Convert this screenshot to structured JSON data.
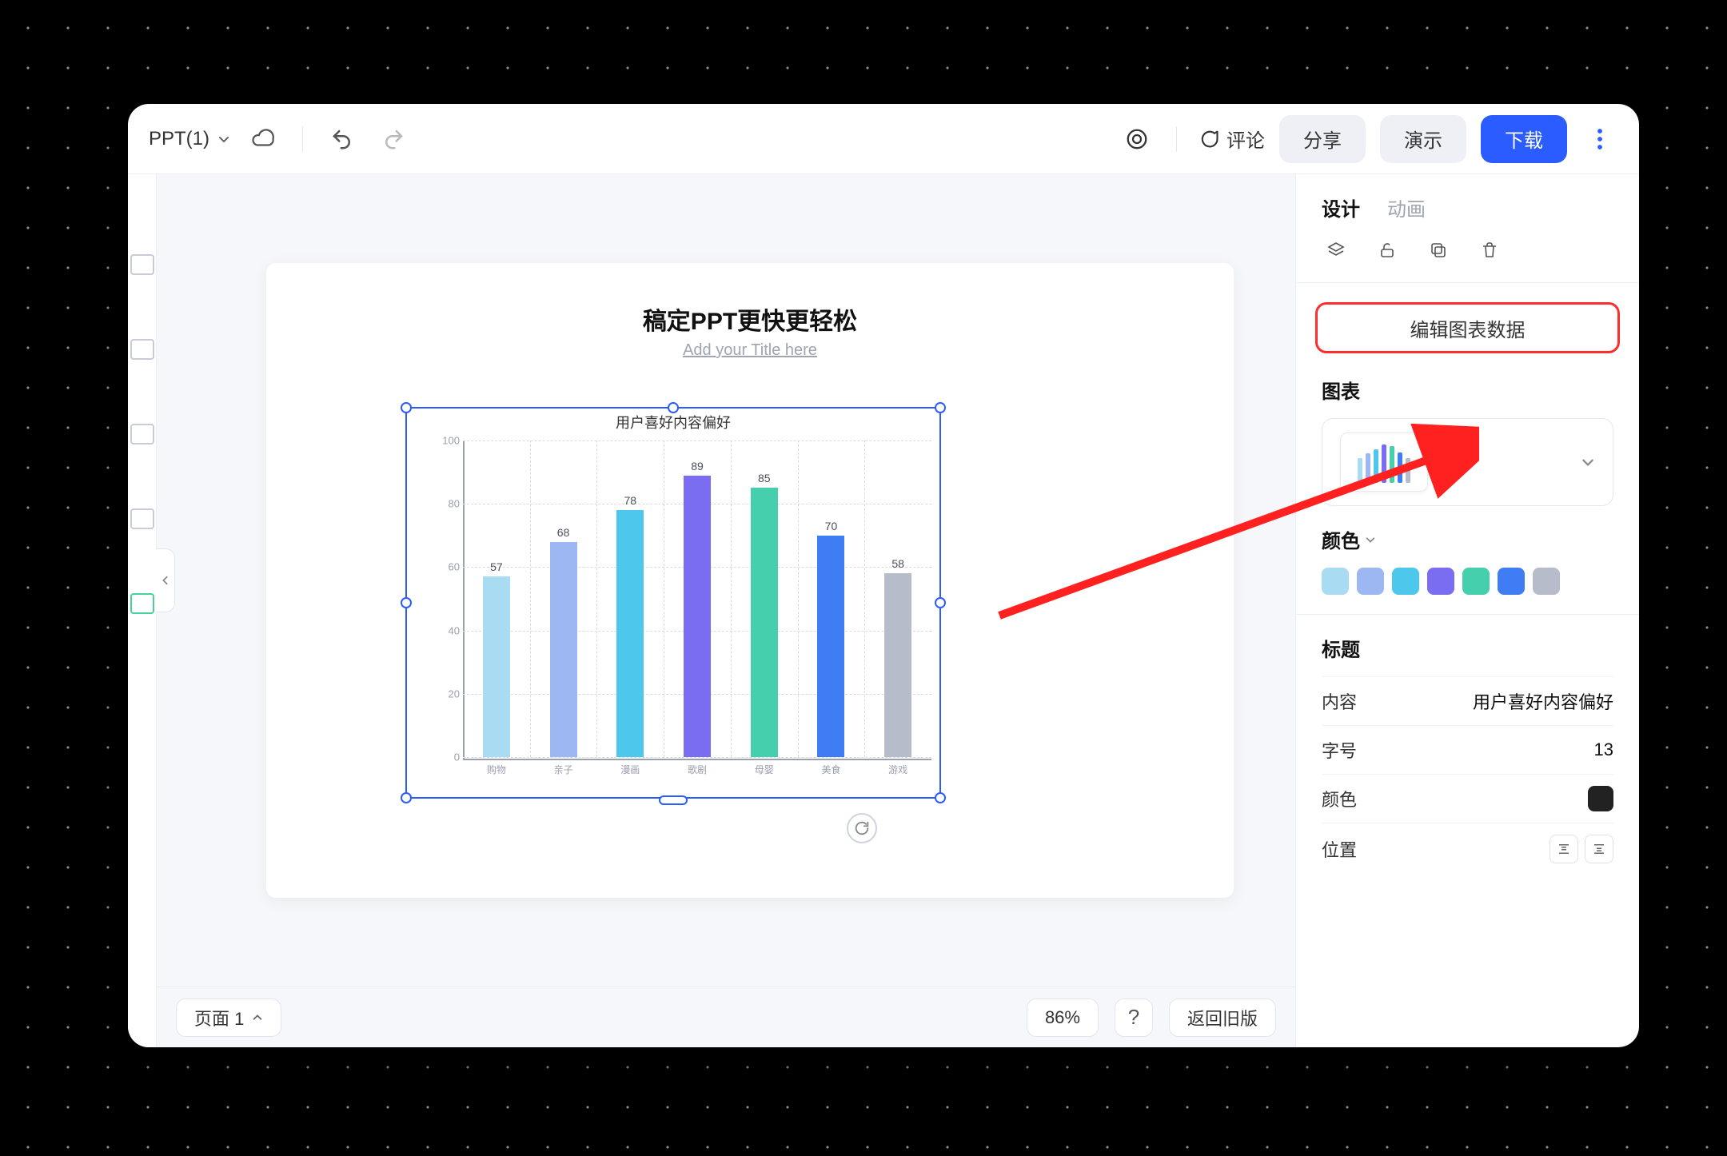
{
  "file": {
    "name": "PPT(1)"
  },
  "toolbar": {
    "comment_label": "评论",
    "share_label": "分享",
    "present_label": "演示",
    "download_label": "下载"
  },
  "slide": {
    "title": "稿定PPT更快更轻松",
    "subtitle": "Add your Title here"
  },
  "chart_data": {
    "type": "bar",
    "title": "用户喜好内容偏好",
    "ylim": [
      0,
      100
    ],
    "yticks": [
      0,
      20,
      40,
      60,
      80,
      100
    ],
    "categories": [
      "购物",
      "亲子",
      "漫画",
      "歌剧",
      "母婴",
      "美食",
      "游戏"
    ],
    "values": [
      57,
      68,
      78,
      89,
      85,
      70,
      58
    ],
    "colors": [
      "#a9dcf3",
      "#9cb7f2",
      "#4ec7ec",
      "#7b6df2",
      "#46cfac",
      "#3f7df5",
      "#b6bcc9"
    ]
  },
  "bottom": {
    "page_label": "页面 1",
    "zoom": "86%",
    "legacy_label": "返回旧版"
  },
  "panel": {
    "tabs": {
      "design": "设计",
      "animation": "动画"
    },
    "edit_data_btn": "编辑图表数据",
    "chart_section": "图表",
    "color_section": "颜色",
    "title_section": "标题",
    "content_label": "内容",
    "content_value": "用户喜好内容偏好",
    "fontsize_label": "字号",
    "fontsize_value": "13",
    "color_label": "颜色",
    "position_label": "位置"
  }
}
